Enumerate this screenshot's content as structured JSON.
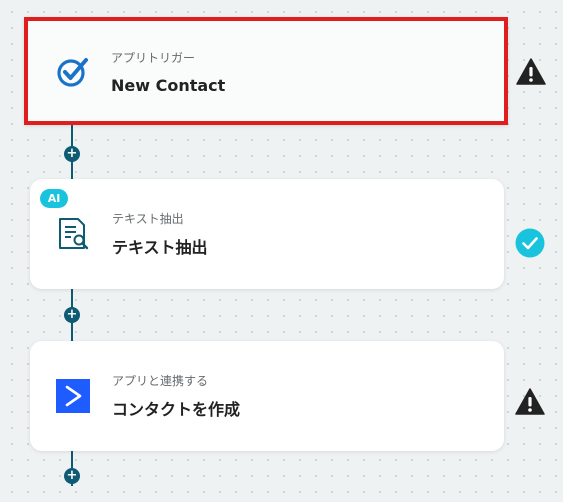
{
  "colors": {
    "background": "#eef2f3",
    "connector": "#0e5b73",
    "selection_border": "#e01e1e",
    "success": "#19c3dd",
    "warning": "#222222",
    "brand_blue": "#1a73c8",
    "activecampaign": "#1e5cff"
  },
  "flow": {
    "plus_label": "+",
    "steps": [
      {
        "caption": "アプリトリガー",
        "title": "New Contact",
        "icon": "activecampaign-check-icon",
        "status": "warning",
        "selected": true
      },
      {
        "badge": "AI",
        "caption": "テキスト抽出",
        "title": "テキスト抽出",
        "icon": "document-search-icon",
        "status": "success",
        "selected": false
      },
      {
        "caption": "アプリと連携する",
        "title": "コンタクトを作成",
        "icon": "activecampaign-arrow-icon",
        "status": "warning",
        "selected": false
      }
    ]
  }
}
